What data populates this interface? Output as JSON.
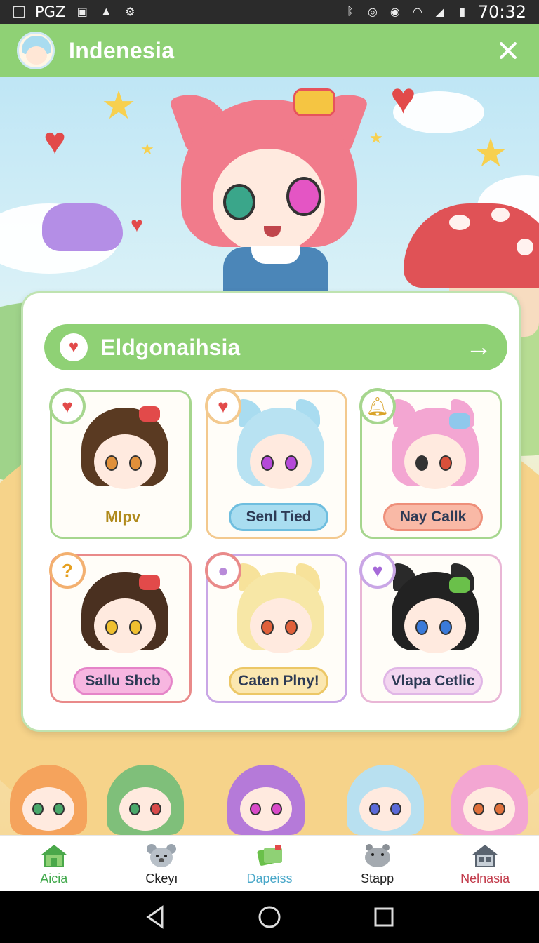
{
  "status_bar": {
    "carrier_text": "PGZ",
    "time": "70:32"
  },
  "app_bar": {
    "title": "Indenesia",
    "close_icon": "close-icon"
  },
  "category": {
    "label": "Eldgonaihsia",
    "icon": "heart-icon",
    "arrow_icon": "arrow-right-icon"
  },
  "characters": [
    {
      "name": "Mlpv",
      "badge_icon": "heart-icon",
      "accent": "#a6d68e"
    },
    {
      "name": "Senl Tied",
      "badge_icon": "heart-icon",
      "accent": "#f3c98e"
    },
    {
      "name": "Nay Callk",
      "badge_icon": "bell-icon",
      "accent": "#a6d68e"
    },
    {
      "name": "Sallu Shcb",
      "badge_icon": "question-icon",
      "accent": "#e98a8a"
    },
    {
      "name": "Caten Plny!",
      "badge_icon": "bubble-icon",
      "accent": "#c9a6e6"
    },
    {
      "name": "Vlapa Cetlic",
      "badge_icon": "heart-icon",
      "accent": "#e9b6d6"
    }
  ],
  "bottom_nav": [
    {
      "label": "Aicia",
      "icon": "home-icon",
      "color": "#3fa84a"
    },
    {
      "label": "Ckeyı",
      "icon": "koala-icon",
      "color": "#222222"
    },
    {
      "label": "Dapeiss",
      "icon": "cards-icon",
      "color": "#4aa8c9"
    },
    {
      "label": "Stapp",
      "icon": "hippo-icon",
      "color": "#222222"
    },
    {
      "label": "Nelnasia",
      "icon": "house-icon",
      "color": "#c23a4a"
    }
  ],
  "system_nav": [
    "back-icon",
    "home-circle-icon",
    "recents-icon"
  ]
}
